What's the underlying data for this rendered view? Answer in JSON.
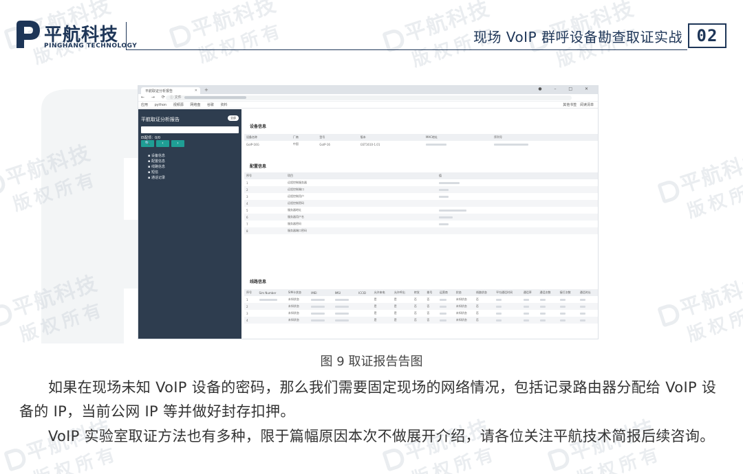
{
  "header": {
    "logo_cn": "平航科技",
    "logo_en": "PINGHANG TECHNOLOGY",
    "title": "现场 VoIP 群呼设备勘查取证实战",
    "chapter": "02"
  },
  "watermark": {
    "line1": "平航科技",
    "line2": "版权所有"
  },
  "browser": {
    "tab_title": "平航取证分析报告",
    "url_prefix": "文件",
    "bookmarks": [
      "应用",
      "python",
      "视频源",
      "网络盘",
      "谷歌",
      "资料"
    ],
    "bookmarks_right": [
      "其他书签",
      "阅读清单"
    ],
    "sidebar": {
      "title": "平航取证分析报告",
      "toggle": "全部",
      "count": "匹配项：0/0",
      "buttons": [
        "🔍",
        "‹",
        "›"
      ],
      "menu": [
        "设备信息",
        "配置信息",
        "线路信息",
        "短信",
        "通话记录"
      ]
    },
    "device_section": {
      "title": "设备信息",
      "headers": [
        "设备名称",
        "厂商",
        "型号",
        "版本",
        "MAC地址",
        "序列号"
      ],
      "row": [
        "GoIP-16G",
        "中国",
        "GoIP-16",
        "GST1610-1.01",
        "",
        ""
      ]
    },
    "config_section": {
      "title": "配置信息",
      "headers": [
        "序号",
        "项目",
        "值"
      ],
      "rows": [
        [
          "1",
          "远程控制服务器",
          ""
        ],
        [
          "2",
          "远程控制端口",
          ""
        ],
        [
          "3",
          "远程控制用户",
          ""
        ],
        [
          "4",
          "远程控制密码",
          ""
        ],
        [
          "5",
          "服务器地址",
          ""
        ],
        [
          "6",
          "服务器用户名",
          ""
        ],
        [
          "7",
          "服务器密码",
          ""
        ],
        [
          "8",
          "服务器端口密码",
          ""
        ]
      ]
    },
    "line_section": {
      "title": "线路信息",
      "headers": [
        "序号",
        "Sim Number",
        "SIM卡状态",
        "IMEI",
        "IMSI",
        "ICCID",
        "允许来电",
        "允许呼出",
        "转发",
        "拨号",
        "运营商",
        "状态",
        "线路状态",
        "平均通话时间",
        "通话率",
        "通话次数",
        "接打次数",
        "通话时长"
      ],
      "rows": [
        [
          "1",
          "",
          "未知状态",
          "",
          "",
          "",
          "是",
          "是",
          "否",
          "否",
          "",
          "未知状态",
          "否",
          "",
          "",
          "",
          "",
          ""
        ],
        [
          "2",
          "",
          "未知状态",
          "",
          "",
          "",
          "是",
          "是",
          "否",
          "否",
          "",
          "未知状态",
          "否",
          "",
          "",
          "",
          "",
          ""
        ],
        [
          "3",
          "",
          "未知状态",
          "",
          "",
          "",
          "是",
          "是",
          "否",
          "否",
          "",
          "未知状态",
          "否",
          "",
          "",
          "",
          "",
          ""
        ],
        [
          "4",
          "",
          "未知状态",
          "",
          "",
          "",
          "是",
          "是",
          "否",
          "否",
          "",
          "未知状态",
          "否",
          "",
          "",
          "",
          "",
          ""
        ]
      ]
    }
  },
  "caption": "图 9 取证报告告图",
  "paragraphs": [
    "如果在现场未知 VoIP 设备的密码，那么我们需要固定现场的网络情况，包括记录路由器分配给 VoIP 设备的 IP，当前公网 IP 等并做好封存扣押。",
    "VoIP 实验室取证方法也有多种，限于篇幅原因本次不做展开介绍，请各位关注平航技术简报后续咨询。"
  ],
  "colors": {
    "brand": "#1d3557",
    "sidebar_bg": "#2e3d4f",
    "button_teal": "#1f9e95"
  }
}
